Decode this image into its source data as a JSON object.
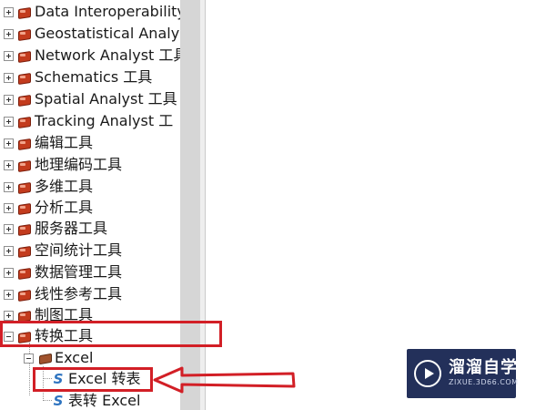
{
  "tree": {
    "toolboxes": [
      {
        "label": "Data Interoperability",
        "state": "collapsed"
      },
      {
        "label": "Geostatistical Analys",
        "state": "collapsed"
      },
      {
        "label": "Network Analyst 工具",
        "state": "collapsed"
      },
      {
        "label": "Schematics 工具",
        "state": "collapsed"
      },
      {
        "label": "Spatial Analyst 工具",
        "state": "collapsed"
      },
      {
        "label": "Tracking Analyst 工",
        "state": "collapsed"
      },
      {
        "label": "编辑工具",
        "state": "collapsed"
      },
      {
        "label": "地理编码工具",
        "state": "collapsed"
      },
      {
        "label": "多维工具",
        "state": "collapsed"
      },
      {
        "label": "分析工具",
        "state": "collapsed"
      },
      {
        "label": "服务器工具",
        "state": "collapsed"
      },
      {
        "label": "空间统计工具",
        "state": "collapsed"
      },
      {
        "label": "数据管理工具",
        "state": "collapsed"
      },
      {
        "label": "线性参考工具",
        "state": "collapsed"
      },
      {
        "label": "制图工具",
        "state": "collapsed"
      },
      {
        "label": "转换工具",
        "state": "expanded"
      }
    ],
    "expanded_toolset": {
      "label": "Excel"
    },
    "tools": [
      {
        "label": "Excel 转表",
        "icon": "script-icon"
      },
      {
        "label": "表转 Excel",
        "icon": "script-icon"
      }
    ]
  },
  "annotation": {
    "highlight_color": "#d21f26"
  },
  "watermark": {
    "brand": "溜溜自学",
    "site": "ZIXUE.3D66.COM"
  }
}
